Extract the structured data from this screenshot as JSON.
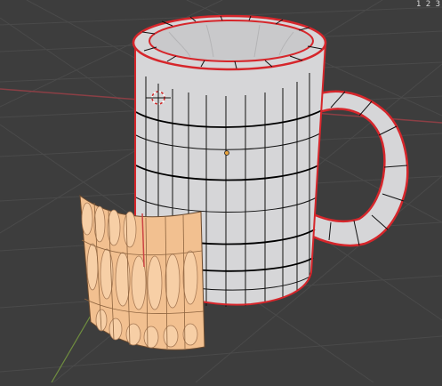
{
  "viewport": {
    "corner_text": "1 2 3",
    "colors": {
      "background": "#3d3d3d",
      "grid": "#4a4a4a",
      "x_axis": "#8b3f45",
      "y_axis": "#6f8d3f",
      "mesh_face": "#d8d8da",
      "mesh_dark": "#c6c6c8",
      "wire": "#111111",
      "selected_edge": "#d6262b",
      "patch": "#f2c090",
      "patch_dark": "#d49f72",
      "origin": "#e7a23d"
    }
  }
}
